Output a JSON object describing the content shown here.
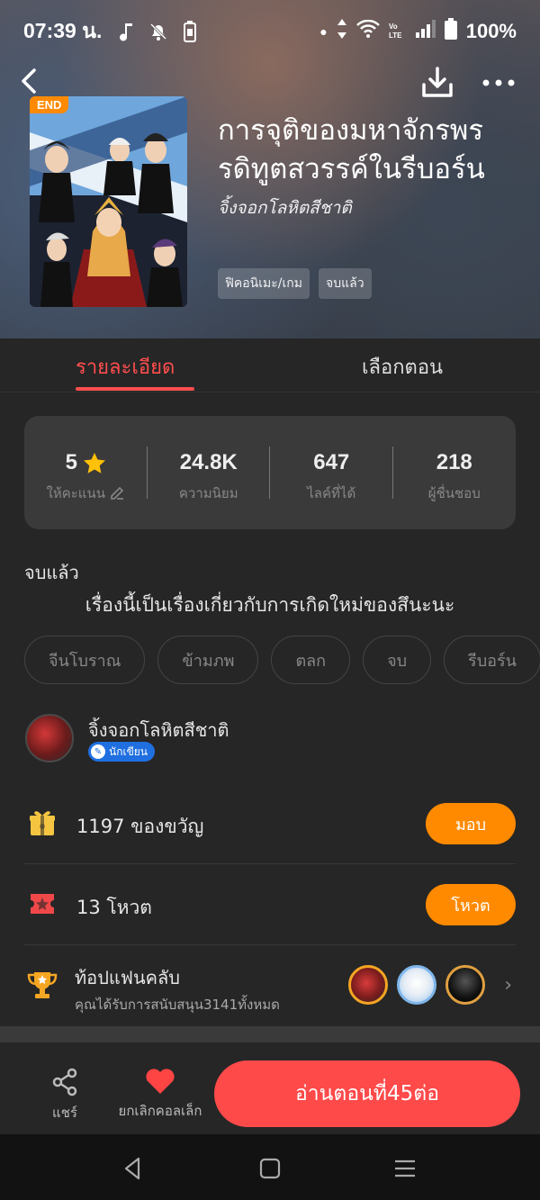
{
  "status_bar": {
    "time": "07:39 น.",
    "battery": "100%"
  },
  "book": {
    "badge": "END",
    "title": "การจุติของมหาจักรพรรดิทูตสวรรค์ในรีบอร์น",
    "author": "จิ้งจอกโลหิตสีชาติ",
    "tags": [
      "ฟิคอนิเมะ/เกม",
      "จบแล้ว"
    ]
  },
  "tabs": {
    "details": "รายละเอียด",
    "chapters": "เลือกตอน"
  },
  "stats": [
    {
      "value": "5",
      "label": "ให้คะแนน"
    },
    {
      "value": "24.8K",
      "label": "ความนิยม"
    },
    {
      "value": "647",
      "label": "ไลค์ที่ได้"
    },
    {
      "value": "218",
      "label": "ผู้ชื่นชอบ"
    }
  ],
  "status": "จบแล้ว",
  "description": "เรื่องนี้เป็นเรื่องเกี่ยวกับการเกิดใหม่ของสึนะนะ",
  "genres": [
    "จีนโบราณ",
    "ข้ามภพ",
    "ตลก",
    "จบ",
    "รีบอร์น"
  ],
  "author_section": {
    "name": "จิ้งจอกโลหิตสีชาติ",
    "badge": "นักเขียน"
  },
  "gift": {
    "text": "1197 ของขวัญ",
    "button": "มอบ"
  },
  "vote": {
    "text": "13 โหวต",
    "button": "โหวต"
  },
  "fanclub": {
    "title": "ท้อปแฟนคลับ",
    "subtitle": "คุณได้รับการสนับสนุน3141ทั้งหมด"
  },
  "bottom": {
    "share": "แชร์",
    "unfavorite": "ยกเลิกคอลเล็ก",
    "read": "อ่านตอนที่45ต่อ"
  },
  "colors": {
    "accent_red": "#ff4d4d",
    "accent_orange": "#ff8a00",
    "background": "#262626"
  }
}
